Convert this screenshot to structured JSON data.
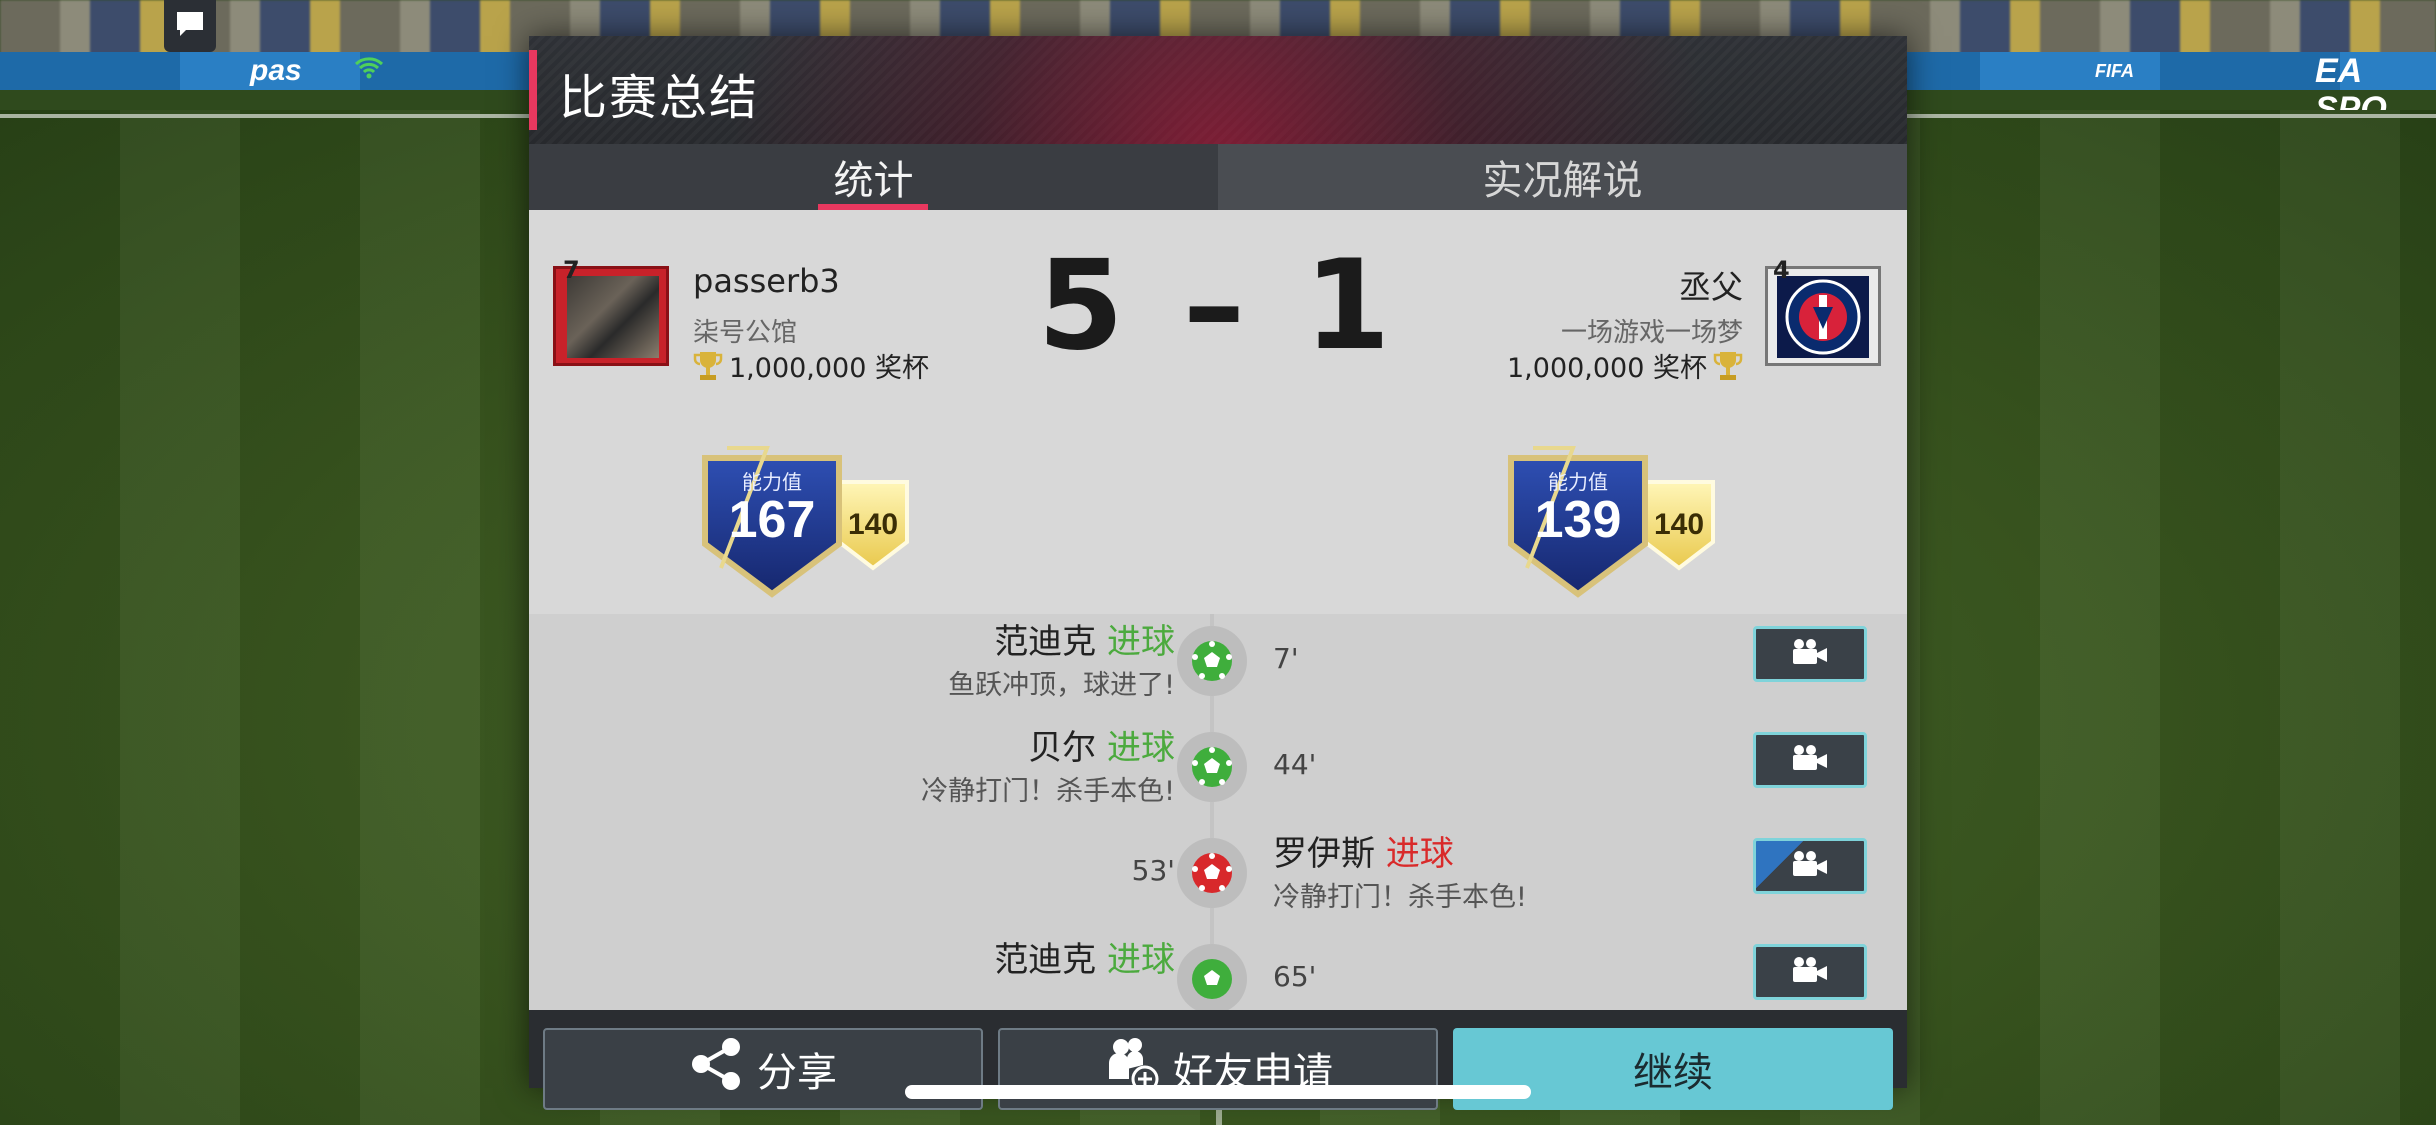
{
  "background": {
    "board_left_text": "pas",
    "board_right_text": "EA SPO",
    "board_mid_text": "FIFA"
  },
  "modal": {
    "title": "比赛总结",
    "tabs": [
      {
        "label": "统计",
        "active": true
      },
      {
        "label": "实况解说",
        "active": false
      }
    ]
  },
  "home": {
    "crest_level": "7",
    "player_name": "passerb3",
    "club_name": "柒号公馆",
    "trophies": "1,000,000 奖杯",
    "rating_label": "能力值",
    "rating_value": "167",
    "rating_secondary": "140"
  },
  "away": {
    "crest_level": "4",
    "player_name": "丞父",
    "club_name": "一场游戏一场梦",
    "trophies": "1,000,000 奖杯",
    "rating_label": "能力值",
    "rating_value": "139",
    "rating_secondary": "140"
  },
  "score": {
    "text": "5 – 1"
  },
  "events": [
    {
      "side": "home",
      "player": "范迪克",
      "type": "进球",
      "desc": "鱼跃冲顶，球进了!",
      "minute": "7'"
    },
    {
      "side": "home",
      "player": "贝尔",
      "type": "进球",
      "desc": "冷静打门！杀手本色!",
      "minute": "44'"
    },
    {
      "side": "away",
      "player": "罗伊斯",
      "type": "进球",
      "desc": "冷静打门！杀手本色!",
      "minute": "53'"
    },
    {
      "side": "home",
      "player": "范迪克",
      "type": "进球",
      "desc": "",
      "minute": "65'"
    }
  ],
  "footer": {
    "share_label": "分享",
    "friend_label": "好友申请",
    "continue_label": "继续"
  },
  "colors": {
    "accent": "#e8385f",
    "continue": "#67c8d4",
    "goal_home": "#4caa3e",
    "goal_away": "#d92a2a"
  },
  "icons": [
    "chat-icon",
    "wifi-icon",
    "trophy-icon",
    "soccer-ball-icon",
    "video-camera-icon",
    "share-icon",
    "add-friend-icon"
  ]
}
